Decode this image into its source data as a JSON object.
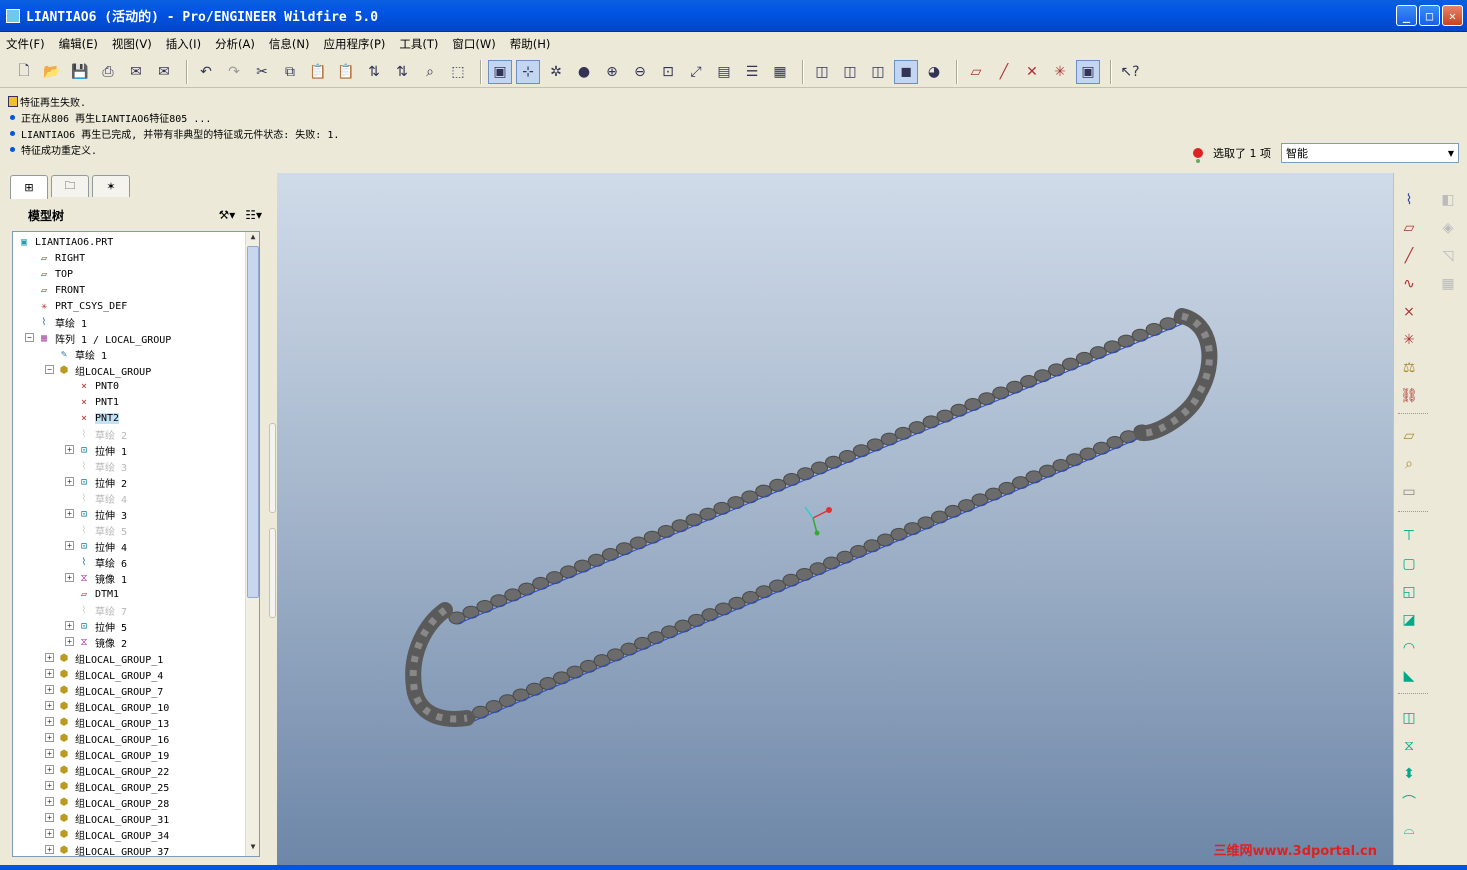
{
  "window": {
    "title": "LIANTIAO6 (活动的) - Pro/ENGINEER Wildfire 5.0",
    "minimize_icon": "minimize-icon",
    "maximize_icon": "maximize-icon",
    "close_icon": "close-icon"
  },
  "menu": [
    "文件(F)",
    "编辑(E)",
    "视图(V)",
    "插入(I)",
    "分析(A)",
    "信息(N)",
    "应用程序(P)",
    "工具(T)",
    "窗口(W)",
    "帮助(H)"
  ],
  "messages": [
    "特征再生失败.",
    "正在从806 再生LIANTIAO6特征805 ...",
    "LIANTIAO6 再生已完成, 并带有非典型的特征或元件状态: 失败: 1.",
    "特征成功重定义."
  ],
  "selection": {
    "status": "选取了 1 项",
    "filter": "智能"
  },
  "model_tree": {
    "title": "模型树",
    "items": [
      {
        "label": "LIANTIAO6.PRT",
        "icon": "part-icon",
        "indent": 0,
        "expander": "none",
        "state": "normal"
      },
      {
        "label": "RIGHT",
        "icon": "datum-plane-icon",
        "indent": 1,
        "expander": "none",
        "state": "normal"
      },
      {
        "label": "TOP",
        "icon": "datum-plane-icon",
        "indent": 1,
        "expander": "none",
        "state": "normal"
      },
      {
        "label": "FRONT",
        "icon": "datum-plane-icon",
        "indent": 1,
        "expander": "none",
        "state": "normal"
      },
      {
        "label": "PRT_CSYS_DEF",
        "icon": "csys-icon",
        "indent": 1,
        "expander": "none",
        "state": "normal"
      },
      {
        "label": "草绘 1",
        "icon": "sketch-icon",
        "indent": 1,
        "expander": "none",
        "state": "normal"
      },
      {
        "label": "阵列 1 / LOCAL_GROUP",
        "icon": "pattern-icon",
        "indent": 1,
        "expander": "minus",
        "state": "normal"
      },
      {
        "label": "草绘 1",
        "icon": "sketch-edit-icon",
        "indent": 2,
        "expander": "none",
        "state": "normal"
      },
      {
        "label": "组LOCAL_GROUP",
        "icon": "group-icon",
        "indent": 2,
        "expander": "minus",
        "state": "normal"
      },
      {
        "label": "PNT0",
        "icon": "datum-point-icon",
        "indent": 3,
        "expander": "none",
        "state": "normal"
      },
      {
        "label": "PNT1",
        "icon": "datum-point-icon",
        "indent": 3,
        "expander": "none",
        "state": "normal"
      },
      {
        "label": "PNT2",
        "icon": "datum-point-icon",
        "indent": 3,
        "expander": "none",
        "state": "selected"
      },
      {
        "label": "草绘 2",
        "icon": "sketch-icon",
        "indent": 3,
        "expander": "none",
        "state": "dim"
      },
      {
        "label": "拉伸 1",
        "icon": "extrude-icon",
        "indent": 3,
        "expander": "plus",
        "state": "normal"
      },
      {
        "label": "草绘 3",
        "icon": "sketch-icon",
        "indent": 3,
        "expander": "none",
        "state": "dim"
      },
      {
        "label": "拉伸 2",
        "icon": "extrude-icon",
        "indent": 3,
        "expander": "plus",
        "state": "normal"
      },
      {
        "label": "草绘 4",
        "icon": "sketch-icon",
        "indent": 3,
        "expander": "none",
        "state": "dim"
      },
      {
        "label": "拉伸 3",
        "icon": "extrude-icon",
        "indent": 3,
        "expander": "plus",
        "state": "normal"
      },
      {
        "label": "草绘 5",
        "icon": "sketch-icon",
        "indent": 3,
        "expander": "none",
        "state": "dim"
      },
      {
        "label": "拉伸 4",
        "icon": "extrude-icon",
        "indent": 3,
        "expander": "plus",
        "state": "normal"
      },
      {
        "label": "草绘 6",
        "icon": "sketch-icon",
        "indent": 3,
        "expander": "none",
        "state": "normal"
      },
      {
        "label": "镜像 1",
        "icon": "mirror-icon",
        "indent": 3,
        "expander": "plus",
        "state": "normal"
      },
      {
        "label": "DTM1",
        "icon": "datum-plane-icon",
        "indent": 3,
        "expander": "none",
        "state": "normal"
      },
      {
        "label": "草绘 7",
        "icon": "sketch-icon",
        "indent": 3,
        "expander": "none",
        "state": "dim"
      },
      {
        "label": "拉伸 5",
        "icon": "extrude-icon",
        "indent": 3,
        "expander": "plus",
        "state": "normal"
      },
      {
        "label": "镜像 2",
        "icon": "mirror-icon",
        "indent": 3,
        "expander": "plus",
        "state": "normal"
      },
      {
        "label": "组LOCAL_GROUP_1",
        "icon": "group-icon",
        "indent": 2,
        "expander": "plus",
        "state": "normal"
      },
      {
        "label": "组LOCAL_GROUP_4",
        "icon": "group-icon",
        "indent": 2,
        "expander": "plus",
        "state": "normal"
      },
      {
        "label": "组LOCAL_GROUP_7",
        "icon": "group-icon",
        "indent": 2,
        "expander": "plus",
        "state": "normal"
      },
      {
        "label": "组LOCAL_GROUP_10",
        "icon": "group-icon",
        "indent": 2,
        "expander": "plus",
        "state": "normal"
      },
      {
        "label": "组LOCAL_GROUP_13",
        "icon": "group-icon",
        "indent": 2,
        "expander": "plus",
        "state": "normal"
      },
      {
        "label": "组LOCAL_GROUP_16",
        "icon": "group-icon",
        "indent": 2,
        "expander": "plus",
        "state": "normal"
      },
      {
        "label": "组LOCAL_GROUP_19",
        "icon": "group-icon",
        "indent": 2,
        "expander": "plus",
        "state": "normal"
      },
      {
        "label": "组LOCAL_GROUP_22",
        "icon": "group-icon",
        "indent": 2,
        "expander": "plus",
        "state": "normal"
      },
      {
        "label": "组LOCAL_GROUP_25",
        "icon": "group-icon",
        "indent": 2,
        "expander": "plus",
        "state": "normal"
      },
      {
        "label": "组LOCAL_GROUP_28",
        "icon": "group-icon",
        "indent": 2,
        "expander": "plus",
        "state": "normal"
      },
      {
        "label": "组LOCAL_GROUP_31",
        "icon": "group-icon",
        "indent": 2,
        "expander": "plus",
        "state": "normal"
      },
      {
        "label": "组LOCAL_GROUP_34",
        "icon": "group-icon",
        "indent": 2,
        "expander": "plus",
        "state": "normal"
      },
      {
        "label": "组LOCAL_GROUP_37",
        "icon": "group-icon",
        "indent": 2,
        "expander": "plus",
        "state": "normal"
      }
    ]
  },
  "toolbar_icons": [
    "new-icon",
    "open-icon",
    "save-icon",
    "print-icon",
    "email-icon",
    "email-link-icon",
    "undo-icon",
    "redo-icon",
    "cut-icon",
    "copy-icon",
    "paste-icon",
    "paste-special-icon",
    "regenerate-icon",
    "regen-manager-icon",
    "find-icon",
    "select-box-icon",
    "repaint-icon",
    "orient-icon",
    "spin-center-icon",
    "shading-icon",
    "zoom-in-icon",
    "zoom-out-icon",
    "refit-icon",
    "reorient-icon",
    "saved-views-icon",
    "layers-icon",
    "view-manager-icon",
    "wireframe-icon",
    "hidden-line-icon",
    "no-hidden-icon",
    "shaded-icon",
    "enhanced-realism-icon",
    "datum-planes-icon",
    "datum-axes-icon",
    "datum-points-icon",
    "csys-display-icon",
    "annotations-icon",
    "context-help-icon"
  ],
  "watermark": "三维网www.3dportal.cn"
}
